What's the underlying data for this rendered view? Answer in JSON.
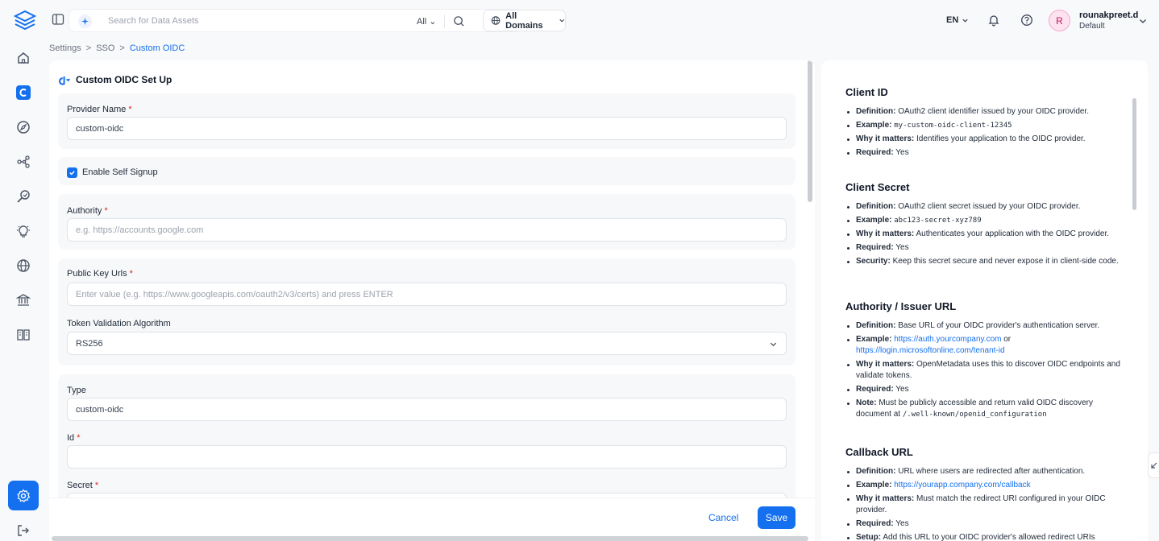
{
  "topbar": {
    "search_placeholder": "Search for Data Assets",
    "search_scope": "All",
    "domain_label": "All Domains",
    "language": "EN",
    "user": {
      "initial": "R",
      "name": "rounakpreet.d",
      "role": "Default"
    }
  },
  "breadcrumb": [
    "Settings",
    ">",
    "SSO",
    ">",
    "Custom OIDC"
  ],
  "form": {
    "title": "Custom OIDC Set Up",
    "provider_name": {
      "label": "Provider Name",
      "required": "*",
      "value": "custom-oidc"
    },
    "self_signup": {
      "label": "Enable Self Signup",
      "checked": true
    },
    "authority": {
      "label": "Authority",
      "required": "*",
      "placeholder": "e.g. https://accounts.google.com"
    },
    "public_key_urls": {
      "label": "Public Key Urls",
      "required": "*",
      "placeholder": "Enter value (e.g. https://www.googleapis.com/oauth2/v3/certs) and press ENTER"
    },
    "token_algorithm": {
      "label": "Token Validation Algorithm",
      "value": "RS256"
    },
    "type": {
      "label": "Type",
      "value": "custom-oidc"
    },
    "id": {
      "label": "Id",
      "required": "*",
      "value": ""
    },
    "secret": {
      "label": "Secret",
      "required": "*"
    },
    "cancel_label": "Cancel",
    "save_label": "Save"
  },
  "docs": {
    "client_id": {
      "title": "Client ID",
      "def_k": "Definition:",
      "def_v": " OAuth2 client identifier issued by your OIDC provider.",
      "ex_k": "Example:",
      "ex_v": "my-custom-oidc-client-12345",
      "why_k": "Why it matters:",
      "why_v": " Identifies your application to the OIDC provider.",
      "req_k": "Required:",
      "req_v": " Yes"
    },
    "client_secret": {
      "title": "Client Secret",
      "def_k": "Definition:",
      "def_v": " OAuth2 client secret issued by your OIDC provider.",
      "ex_k": "Example:",
      "ex_v": "abc123-secret-xyz789",
      "why_k": "Why it matters:",
      "why_v": " Authenticates your application with the OIDC provider.",
      "req_k": "Required:",
      "req_v": " Yes",
      "sec_k": "Security:",
      "sec_v": " Keep this secret secure and never expose it in client-side code."
    },
    "authority": {
      "title": "Authority / Issuer URL",
      "def_k": "Definition:",
      "def_v": " Base URL of your OIDC provider's authentication server.",
      "ex_k": "Example:",
      "ex_link1": "https://auth.yourcompany.com",
      "ex_or": " or ",
      "ex_link2": "https://login.microsoftonline.com/tenant-id",
      "why_k": "Why it matters:",
      "why_v": " OpenMetadata uses this to discover OIDC endpoints and validate tokens.",
      "req_k": "Required:",
      "req_v": " Yes",
      "note_k": "Note:",
      "note_v": " Must be publicly accessible and return valid OIDC discovery document at ",
      "note_code": "/.well-known/openid_configuration"
    },
    "callback": {
      "title": "Callback URL",
      "def_k": "Definition:",
      "def_v": " URL where users are redirected after authentication.",
      "ex_k": "Example:",
      "ex_link": "https://yourapp.company.com/callback",
      "why_k": "Why it matters:",
      "why_v": " Must match the redirect URI configured in your OIDC provider.",
      "req_k": "Required:",
      "req_v": " Yes",
      "setup_k": "Setup:",
      "setup_v": " Add this URL to your OIDC provider's allowed redirect URIs"
    }
  },
  "colors": {
    "accent": "#1470ef",
    "required": "#dc2626"
  }
}
